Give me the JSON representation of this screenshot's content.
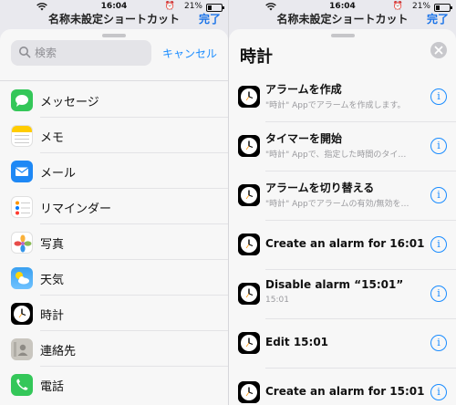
{
  "left": {
    "status": {
      "time": "16:04",
      "battery": "21%"
    },
    "behind": {
      "title": "名称未設定ショートカット",
      "done": "完了"
    },
    "search": {
      "placeholder": "検索",
      "cancel": "キャンセル"
    },
    "apps": [
      {
        "label": "メッセージ",
        "icon": "messages-icon"
      },
      {
        "label": "メモ",
        "icon": "notes-icon"
      },
      {
        "label": "メール",
        "icon": "mail-icon"
      },
      {
        "label": "リマインダー",
        "icon": "reminders-icon"
      },
      {
        "label": "写真",
        "icon": "photos-icon"
      },
      {
        "label": "天気",
        "icon": "weather-icon"
      },
      {
        "label": "時計",
        "icon": "clock-icon"
      },
      {
        "label": "連絡先",
        "icon": "contacts-icon"
      },
      {
        "label": "電話",
        "icon": "phone-icon"
      }
    ]
  },
  "right": {
    "status": {
      "time": "16:04",
      "battery": "21%"
    },
    "behind": {
      "title": "名称未設定ショートカット",
      "done": "完了"
    },
    "title": "時計",
    "actions": [
      {
        "title": "アラームを作成",
        "subtitle": "\"時計\" Appでアラームを作成します。"
      },
      {
        "title": "タイマーを開始",
        "subtitle": "\"時計\" Appで、指定した時間のタイ…"
      },
      {
        "title": "アラームを切り替える",
        "subtitle": "\"時計\" Appでアラームの有効/無効を…"
      },
      {
        "title": "Create an alarm for 16:01",
        "subtitle": ""
      },
      {
        "title": "Disable alarm “15:01”",
        "subtitle": "15:01"
      },
      {
        "title": "Edit 15:01",
        "subtitle": ""
      },
      {
        "title": "Create an alarm for 15:01",
        "subtitle": ""
      }
    ]
  }
}
